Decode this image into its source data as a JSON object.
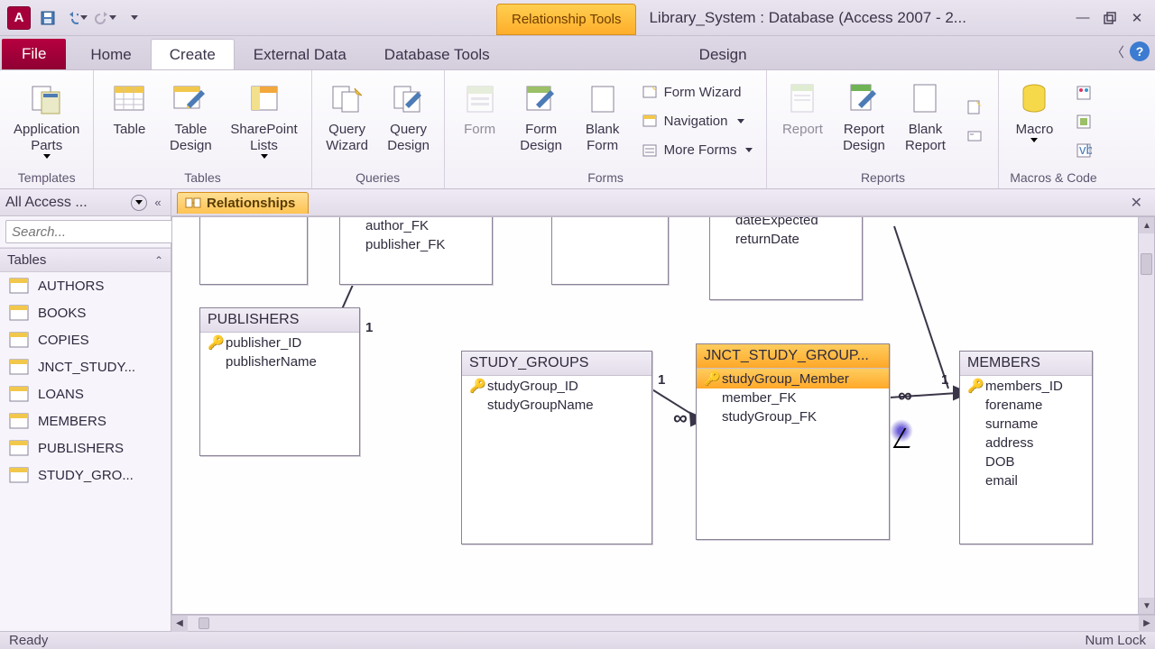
{
  "titlebar": {
    "app_letter": "A",
    "contextual_label": "Relationship Tools",
    "title": "Library_System : Database (Access 2007 - 2..."
  },
  "tabs": {
    "file": "File",
    "home": "Home",
    "create": "Create",
    "external": "External Data",
    "dbtools": "Database Tools",
    "design": "Design"
  },
  "ribbon": {
    "templates": {
      "app_parts": "Application\nParts",
      "label": "Templates"
    },
    "tables": {
      "table": "Table",
      "design": "Table\nDesign",
      "sharepoint": "SharePoint\nLists",
      "label": "Tables"
    },
    "queries": {
      "wizard": "Query\nWizard",
      "design": "Query\nDesign",
      "label": "Queries"
    },
    "forms": {
      "form": "Form",
      "design": "Form\nDesign",
      "blank": "Blank\nForm",
      "wizard": "Form Wizard",
      "nav": "Navigation",
      "more": "More Forms",
      "label": "Forms"
    },
    "reports": {
      "report": "Report",
      "design": "Report\nDesign",
      "blank": "Blank\nReport",
      "label": "Reports"
    },
    "macros": {
      "macro": "Macro",
      "label": "Macros & Code"
    }
  },
  "nav": {
    "header": "All Access ...",
    "search_placeholder": "Search...",
    "group": "Tables",
    "items": [
      "AUTHORS",
      "BOOKS",
      "COPIES",
      "JNCT_STUDY...",
      "LOANS",
      "MEMBERS",
      "PUBLISHERS",
      "STUDY_GRO..."
    ]
  },
  "doc": {
    "tab": "Relationships"
  },
  "diagram": {
    "partial_top": {
      "f1": "author_FK",
      "f2": "publisher_FK"
    },
    "loans_partial": {
      "f1": "dateExpected",
      "f2": "returnDate"
    },
    "publishers": {
      "title": "PUBLISHERS",
      "pk": "publisher_ID",
      "f1": "publisherName"
    },
    "study": {
      "title": "STUDY_GROUPS",
      "pk": "studyGroup_ID",
      "f1": "studyGroupName"
    },
    "jnct": {
      "title": "JNCT_STUDY_GROUP...",
      "pk": "studyGroup_Member",
      "f1": "member_FK",
      "f2": "studyGroup_FK"
    },
    "members": {
      "title": "MEMBERS",
      "pk": "members_ID",
      "f1": "forename",
      "f2": "surname",
      "f3": "address",
      "f4": "DOB",
      "f5": "email"
    },
    "labels": {
      "one_a": "1",
      "inf_a": "∞",
      "one_b": "1",
      "inf_b": "∞",
      "one_c": "1"
    }
  },
  "status": {
    "left": "Ready",
    "right": "Num Lock"
  }
}
